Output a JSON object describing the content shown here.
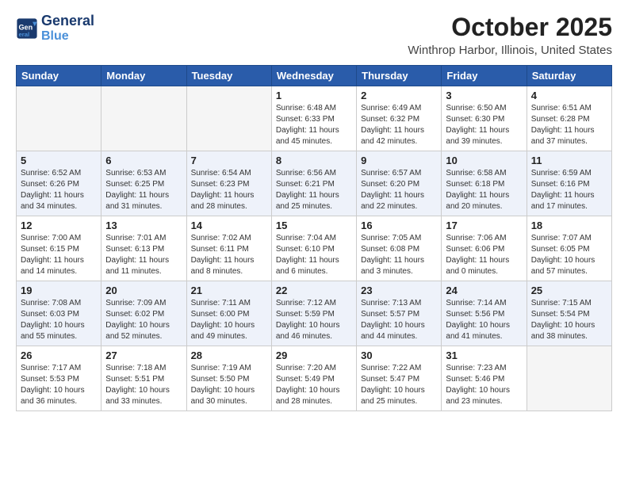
{
  "header": {
    "logo_line1": "General",
    "logo_line2": "Blue",
    "title": "October 2025",
    "subtitle": "Winthrop Harbor, Illinois, United States"
  },
  "weekdays": [
    "Sunday",
    "Monday",
    "Tuesday",
    "Wednesday",
    "Thursday",
    "Friday",
    "Saturday"
  ],
  "weeks": [
    [
      {
        "day": "",
        "info": ""
      },
      {
        "day": "",
        "info": ""
      },
      {
        "day": "",
        "info": ""
      },
      {
        "day": "1",
        "info": "Sunrise: 6:48 AM\nSunset: 6:33 PM\nDaylight: 11 hours\nand 45 minutes."
      },
      {
        "day": "2",
        "info": "Sunrise: 6:49 AM\nSunset: 6:32 PM\nDaylight: 11 hours\nand 42 minutes."
      },
      {
        "day": "3",
        "info": "Sunrise: 6:50 AM\nSunset: 6:30 PM\nDaylight: 11 hours\nand 39 minutes."
      },
      {
        "day": "4",
        "info": "Sunrise: 6:51 AM\nSunset: 6:28 PM\nDaylight: 11 hours\nand 37 minutes."
      }
    ],
    [
      {
        "day": "5",
        "info": "Sunrise: 6:52 AM\nSunset: 6:26 PM\nDaylight: 11 hours\nand 34 minutes."
      },
      {
        "day": "6",
        "info": "Sunrise: 6:53 AM\nSunset: 6:25 PM\nDaylight: 11 hours\nand 31 minutes."
      },
      {
        "day": "7",
        "info": "Sunrise: 6:54 AM\nSunset: 6:23 PM\nDaylight: 11 hours\nand 28 minutes."
      },
      {
        "day": "8",
        "info": "Sunrise: 6:56 AM\nSunset: 6:21 PM\nDaylight: 11 hours\nand 25 minutes."
      },
      {
        "day": "9",
        "info": "Sunrise: 6:57 AM\nSunset: 6:20 PM\nDaylight: 11 hours\nand 22 minutes."
      },
      {
        "day": "10",
        "info": "Sunrise: 6:58 AM\nSunset: 6:18 PM\nDaylight: 11 hours\nand 20 minutes."
      },
      {
        "day": "11",
        "info": "Sunrise: 6:59 AM\nSunset: 6:16 PM\nDaylight: 11 hours\nand 17 minutes."
      }
    ],
    [
      {
        "day": "12",
        "info": "Sunrise: 7:00 AM\nSunset: 6:15 PM\nDaylight: 11 hours\nand 14 minutes."
      },
      {
        "day": "13",
        "info": "Sunrise: 7:01 AM\nSunset: 6:13 PM\nDaylight: 11 hours\nand 11 minutes."
      },
      {
        "day": "14",
        "info": "Sunrise: 7:02 AM\nSunset: 6:11 PM\nDaylight: 11 hours\nand 8 minutes."
      },
      {
        "day": "15",
        "info": "Sunrise: 7:04 AM\nSunset: 6:10 PM\nDaylight: 11 hours\nand 6 minutes."
      },
      {
        "day": "16",
        "info": "Sunrise: 7:05 AM\nSunset: 6:08 PM\nDaylight: 11 hours\nand 3 minutes."
      },
      {
        "day": "17",
        "info": "Sunrise: 7:06 AM\nSunset: 6:06 PM\nDaylight: 11 hours\nand 0 minutes."
      },
      {
        "day": "18",
        "info": "Sunrise: 7:07 AM\nSunset: 6:05 PM\nDaylight: 10 hours\nand 57 minutes."
      }
    ],
    [
      {
        "day": "19",
        "info": "Sunrise: 7:08 AM\nSunset: 6:03 PM\nDaylight: 10 hours\nand 55 minutes."
      },
      {
        "day": "20",
        "info": "Sunrise: 7:09 AM\nSunset: 6:02 PM\nDaylight: 10 hours\nand 52 minutes."
      },
      {
        "day": "21",
        "info": "Sunrise: 7:11 AM\nSunset: 6:00 PM\nDaylight: 10 hours\nand 49 minutes."
      },
      {
        "day": "22",
        "info": "Sunrise: 7:12 AM\nSunset: 5:59 PM\nDaylight: 10 hours\nand 46 minutes."
      },
      {
        "day": "23",
        "info": "Sunrise: 7:13 AM\nSunset: 5:57 PM\nDaylight: 10 hours\nand 44 minutes."
      },
      {
        "day": "24",
        "info": "Sunrise: 7:14 AM\nSunset: 5:56 PM\nDaylight: 10 hours\nand 41 minutes."
      },
      {
        "day": "25",
        "info": "Sunrise: 7:15 AM\nSunset: 5:54 PM\nDaylight: 10 hours\nand 38 minutes."
      }
    ],
    [
      {
        "day": "26",
        "info": "Sunrise: 7:17 AM\nSunset: 5:53 PM\nDaylight: 10 hours\nand 36 minutes."
      },
      {
        "day": "27",
        "info": "Sunrise: 7:18 AM\nSunset: 5:51 PM\nDaylight: 10 hours\nand 33 minutes."
      },
      {
        "day": "28",
        "info": "Sunrise: 7:19 AM\nSunset: 5:50 PM\nDaylight: 10 hours\nand 30 minutes."
      },
      {
        "day": "29",
        "info": "Sunrise: 7:20 AM\nSunset: 5:49 PM\nDaylight: 10 hours\nand 28 minutes."
      },
      {
        "day": "30",
        "info": "Sunrise: 7:22 AM\nSunset: 5:47 PM\nDaylight: 10 hours\nand 25 minutes."
      },
      {
        "day": "31",
        "info": "Sunrise: 7:23 AM\nSunset: 5:46 PM\nDaylight: 10 hours\nand 23 minutes."
      },
      {
        "day": "",
        "info": ""
      }
    ]
  ]
}
